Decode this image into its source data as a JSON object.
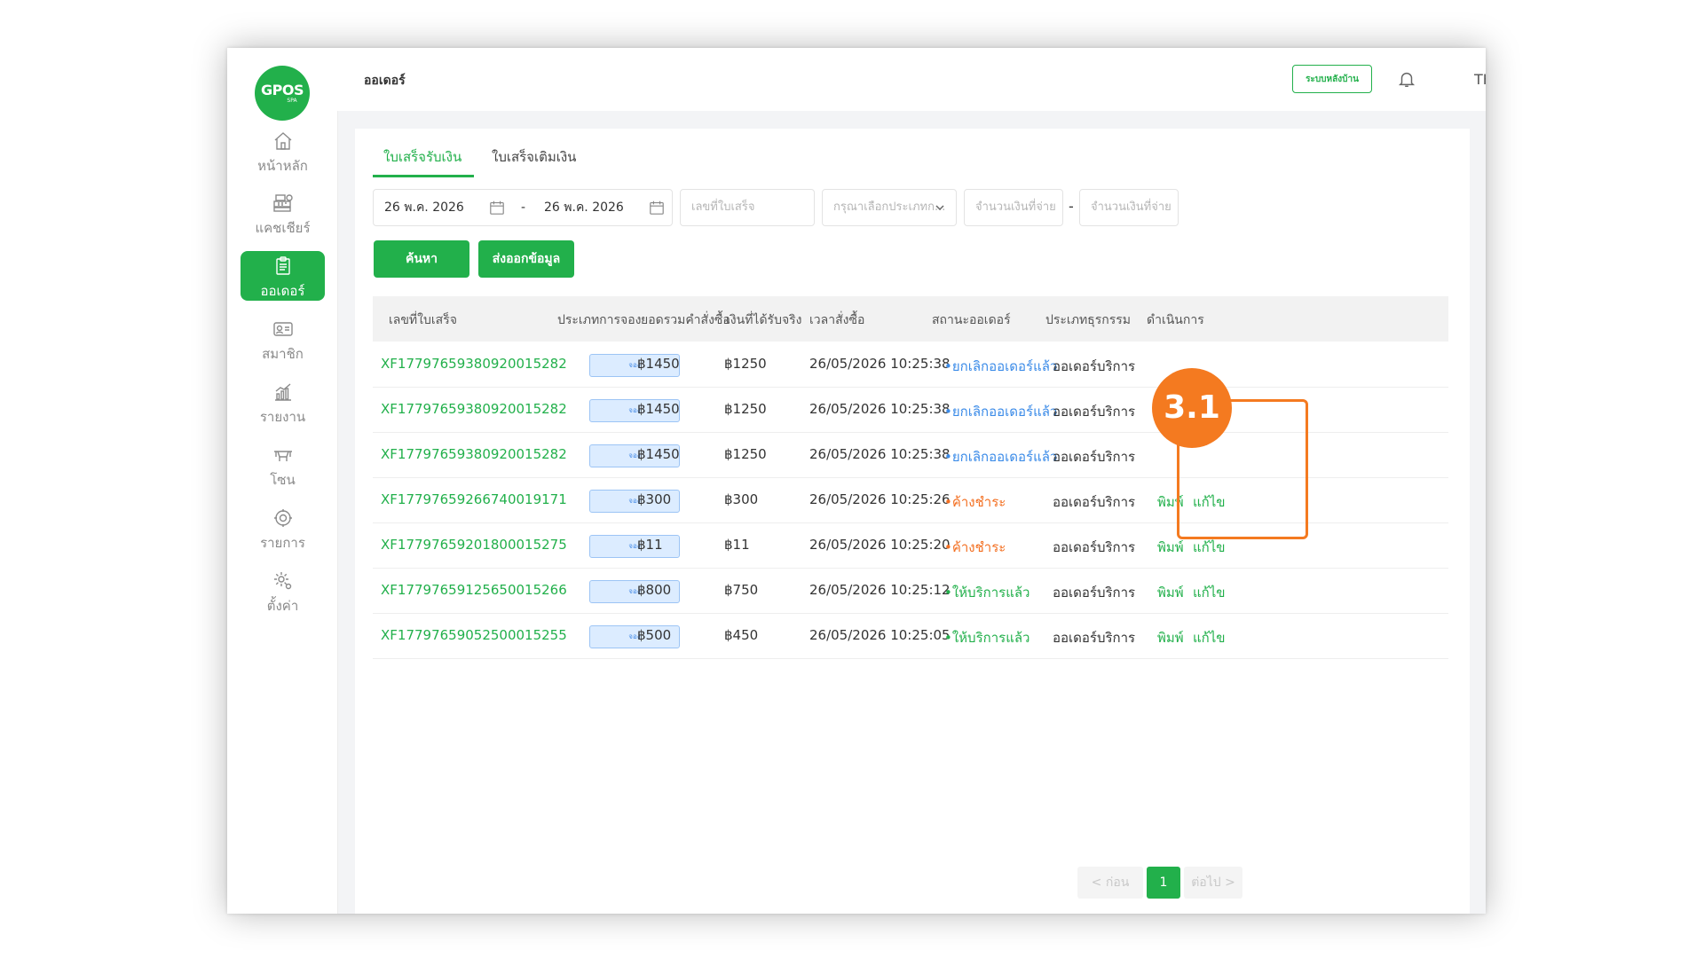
{
  "brand": {
    "logo_main": "GPOS",
    "logo_sub": "SPA"
  },
  "sidebar": {
    "items": [
      {
        "label": "หน้าหลัก",
        "icon": "home-icon",
        "active": false
      },
      {
        "label": "แคชเชียร์",
        "icon": "cash-register-icon",
        "active": false
      },
      {
        "label": "ออเดอร์",
        "icon": "clipboard-icon",
        "active": true
      },
      {
        "label": "สมาชิก",
        "icon": "member-card-icon",
        "active": false
      },
      {
        "label": "รายงาน",
        "icon": "chart-icon",
        "active": false
      },
      {
        "label": "โซน",
        "icon": "zone-icon",
        "active": false
      },
      {
        "label": "รายการ",
        "icon": "spa-item-icon",
        "active": false
      },
      {
        "label": "ตั้งค่า",
        "icon": "gear-icon",
        "active": false
      }
    ]
  },
  "header": {
    "title": "ออเดอร์",
    "backend_button": "ระบบหลังบ้าน",
    "language": "TH"
  },
  "tabs": [
    {
      "label": "ใบเสร็จรับเงิน",
      "active": true
    },
    {
      "label": "ใบเสร็จเติมเงิน",
      "active": false
    }
  ],
  "filters": {
    "date_from": "26 พ.ค. 2026",
    "date_to": "26 พ.ค. 2026",
    "range_separator": "-",
    "invoice_placeholder": "เลขที่ใบเสร็จ",
    "booking_type_placeholder": "กรุณาเลือกประเภทก...",
    "amount_from_placeholder": "จำนวนเงินที่จ่าย",
    "amount_to_placeholder": "จำนวนเงินที่จ่าย"
  },
  "buttons": {
    "search": "ค้นหา",
    "export": "ส่งออกข้อมูล"
  },
  "table": {
    "headers": [
      "เลขที่ใบเสร็จ",
      "ประเภทการจอง",
      "ยอดรวมคำสั่งซื้อ",
      "เงินที่ได้รับจริง",
      "เวลาสั่งซื้อ",
      "สถานะออเดอร์",
      "ประเภทธุรกรรม",
      "ดำเนินการ"
    ],
    "rows": [
      {
        "invoice": "XF17797659380920015282",
        "booking": "จอง",
        "total": "฿1450",
        "received": "฿1250",
        "time": "26/05/2026 10:25:38",
        "status": "•ยกเลิกออเดอร์แล้ว",
        "status_type": "cancel",
        "txn": "ออเดอร์บริการ",
        "print": "",
        "edit": ""
      },
      {
        "invoice": "XF17797659380920015282",
        "booking": "จอง",
        "total": "฿1450",
        "received": "฿1250",
        "time": "26/05/2026 10:25:38",
        "status": "•ยกเลิกออเดอร์แล้ว",
        "status_type": "cancel",
        "txn": "ออเดอร์บริการ",
        "print": "",
        "edit": ""
      },
      {
        "invoice": "XF17797659380920015282",
        "booking": "จอง",
        "total": "฿1450",
        "received": "฿1250",
        "time": "26/05/2026 10:25:38",
        "status": "•ยกเลิกออเดอร์แล้ว",
        "status_type": "cancel",
        "txn": "ออเดอร์บริการ",
        "print": "",
        "edit": ""
      },
      {
        "invoice": "XF17797659266740019171",
        "booking": "จอง",
        "total": "฿300",
        "received": "฿300",
        "time": "26/05/2026 10:25:26",
        "status": "•ค้างชำระ",
        "status_type": "pending",
        "txn": "ออเดอร์บริการ",
        "print": "พิมพ์",
        "edit": "แก้ไข"
      },
      {
        "invoice": "XF17797659201800015275",
        "booking": "จอง",
        "total": "฿11",
        "received": "฿11",
        "time": "26/05/2026 10:25:20",
        "status": "•ค้างชำระ",
        "status_type": "pending",
        "txn": "ออเดอร์บริการ",
        "print": "พิมพ์",
        "edit": "แก้ไข"
      },
      {
        "invoice": "XF17797659125650015266",
        "booking": "จอง",
        "total": "฿800",
        "received": "฿750",
        "time": "26/05/2026 10:25:12",
        "status": "•ให้บริการแล้ว",
        "status_type": "done",
        "txn": "ออเดอร์บริการ",
        "print": "พิมพ์",
        "edit": "แก้ไข"
      },
      {
        "invoice": "XF17797659052500015255",
        "booking": "จอง",
        "total": "฿500",
        "received": "฿450",
        "time": "26/05/2026 10:25:05",
        "status": "•ให้บริการแล้ว",
        "status_type": "done",
        "txn": "ออเดอร์บริการ",
        "print": "พิมพ์",
        "edit": "แก้ไข"
      }
    ]
  },
  "annotation": {
    "step": "3.1",
    "color": "#f47a20"
  },
  "pagination": {
    "prev": "< ก่อน",
    "current": "1",
    "next": "ต่อไป >"
  },
  "colors": {
    "brand_green": "#22b04b",
    "cancel_blue": "#3b8be8",
    "pending_orange": "#f36f21"
  }
}
